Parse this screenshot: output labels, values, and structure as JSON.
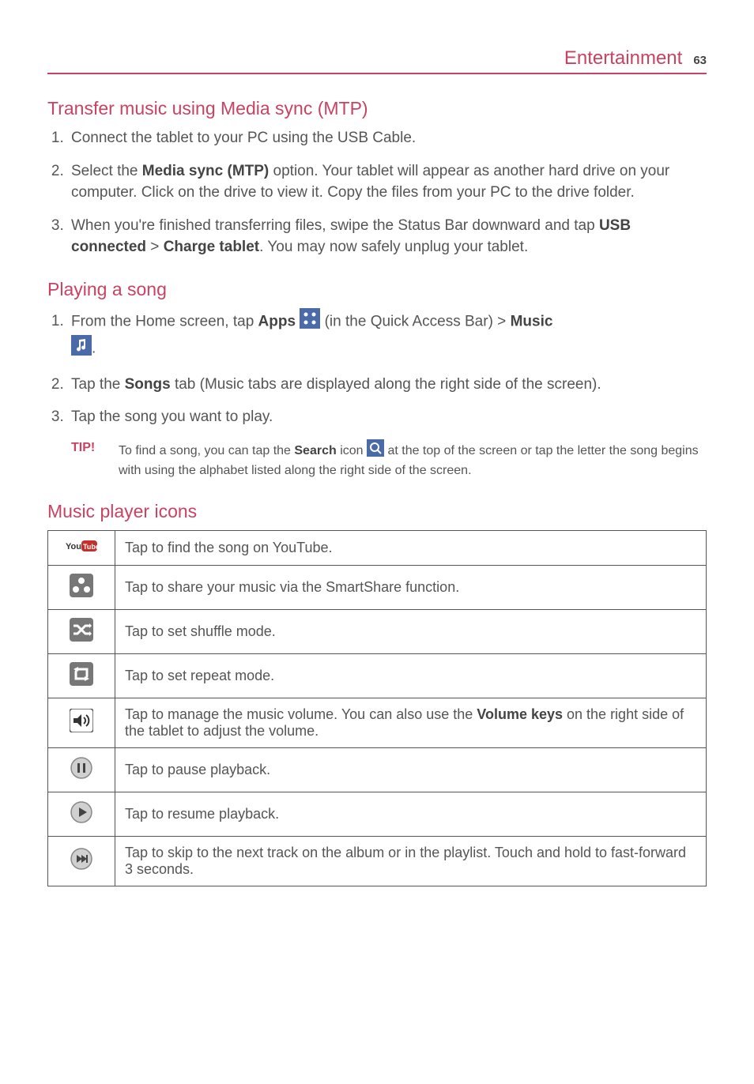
{
  "header": {
    "title": "Entertainment",
    "page_number": "63"
  },
  "section1": {
    "heading": "Transfer music using Media sync (MTP)",
    "steps": {
      "s1": "Connect the tablet to your PC using the USB Cable.",
      "s2_a": "Select the ",
      "s2_bold": "Media sync (MTP)",
      "s2_b": " option. Your tablet will appear as another hard drive on your computer. Click on the drive to view it. Copy the files from your PC to the drive folder.",
      "s3_a": "When you're finished transferring files, swipe the Status Bar downward and tap ",
      "s3_bold1": "USB connected",
      "s3_mid": " > ",
      "s3_bold2": "Charge tablet",
      "s3_b": ". You may now safely unplug your tablet."
    }
  },
  "section2": {
    "heading": "Playing a song",
    "steps": {
      "s1_a": "From the Home screen, tap ",
      "s1_bold1": "Apps",
      "s1_mid": " (in the Quick Access Bar) > ",
      "s1_bold2": "Music",
      "s1_end": ".",
      "s2_a": "Tap the ",
      "s2_bold": "Songs",
      "s2_b": " tab (Music tabs are displayed along the right side of the screen).",
      "s3": "Tap the song you want to play."
    },
    "tip": {
      "label": "TIP!",
      "text_a": "To find a song, you can tap the ",
      "text_bold": "Search",
      "text_b": " icon ",
      "text_c": " at the top of the screen or tap the letter the song begins with using the alphabet listed along the right side of the screen."
    }
  },
  "section3": {
    "heading": "Music player icons",
    "rows": {
      "r1": "Tap to find the song on YouTube.",
      "r2": "Tap to share your music via the SmartShare function.",
      "r3": "Tap to set shuffle mode.",
      "r4": "Tap to set repeat mode.",
      "r5_a": "Tap to manage the music volume. You can also use the ",
      "r5_bold": "Volume keys",
      "r5_b": " on the right side of the tablet to adjust the volume.",
      "r6": "Tap to pause playback.",
      "r7": "Tap to resume playback.",
      "r8": "Tap to skip to the next track on the album or in the playlist. Touch and hold to fast-forward 3 seconds."
    }
  }
}
